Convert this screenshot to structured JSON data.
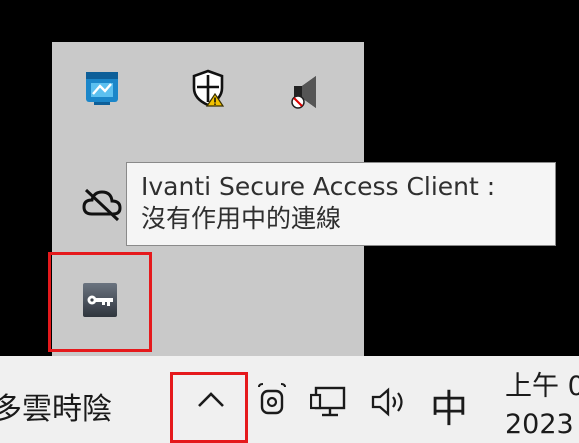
{
  "tooltip": {
    "line1": "Ivanti Secure Access Client :",
    "line2": "沒有作用中的連線"
  },
  "tray_icons": [
    "app-window-icon",
    "shield-warning-icon",
    "speaker-muted-icon",
    "cloud-offline-icon",
    "vpn-key-icon"
  ],
  "taskbar": {
    "weather_text": "多雲時陰",
    "ime_label": "中",
    "clock_line1": "上午 0",
    "clock_line2": "2023"
  },
  "colors": {
    "highlight": "#e5191c",
    "flyout_bg": "#c9c9c9",
    "taskbar_bg": "#f0f0f0"
  }
}
